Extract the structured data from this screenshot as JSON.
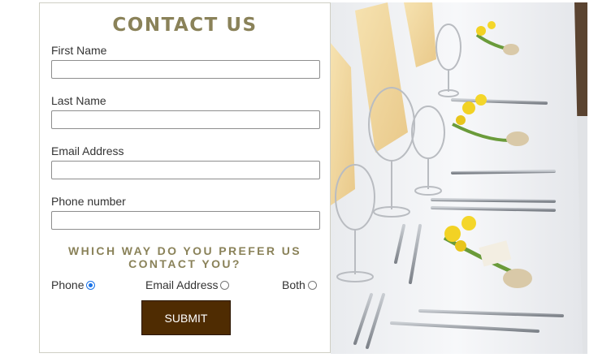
{
  "form": {
    "title": "CONTACT US",
    "fields": [
      {
        "label": "First Name",
        "value": ""
      },
      {
        "label": "Last Name",
        "value": ""
      },
      {
        "label": "Email Address",
        "value": ""
      },
      {
        "label": "Phone number",
        "value": ""
      }
    ],
    "question_line1": "WHICH WAY DO YOU PREFER US",
    "question_line2": "CONTACT YOU?",
    "options": [
      {
        "label": "Phone",
        "checked": true
      },
      {
        "label": "Email Address",
        "checked": false
      },
      {
        "label": "Both",
        "checked": false
      }
    ],
    "submit_label": "SUBMIT"
  },
  "colors": {
    "accent": "#8a8259",
    "button": "#4f2c02",
    "radio_selected": "#1a73e8"
  },
  "image": {
    "description_icon": "table-setting-photo"
  }
}
